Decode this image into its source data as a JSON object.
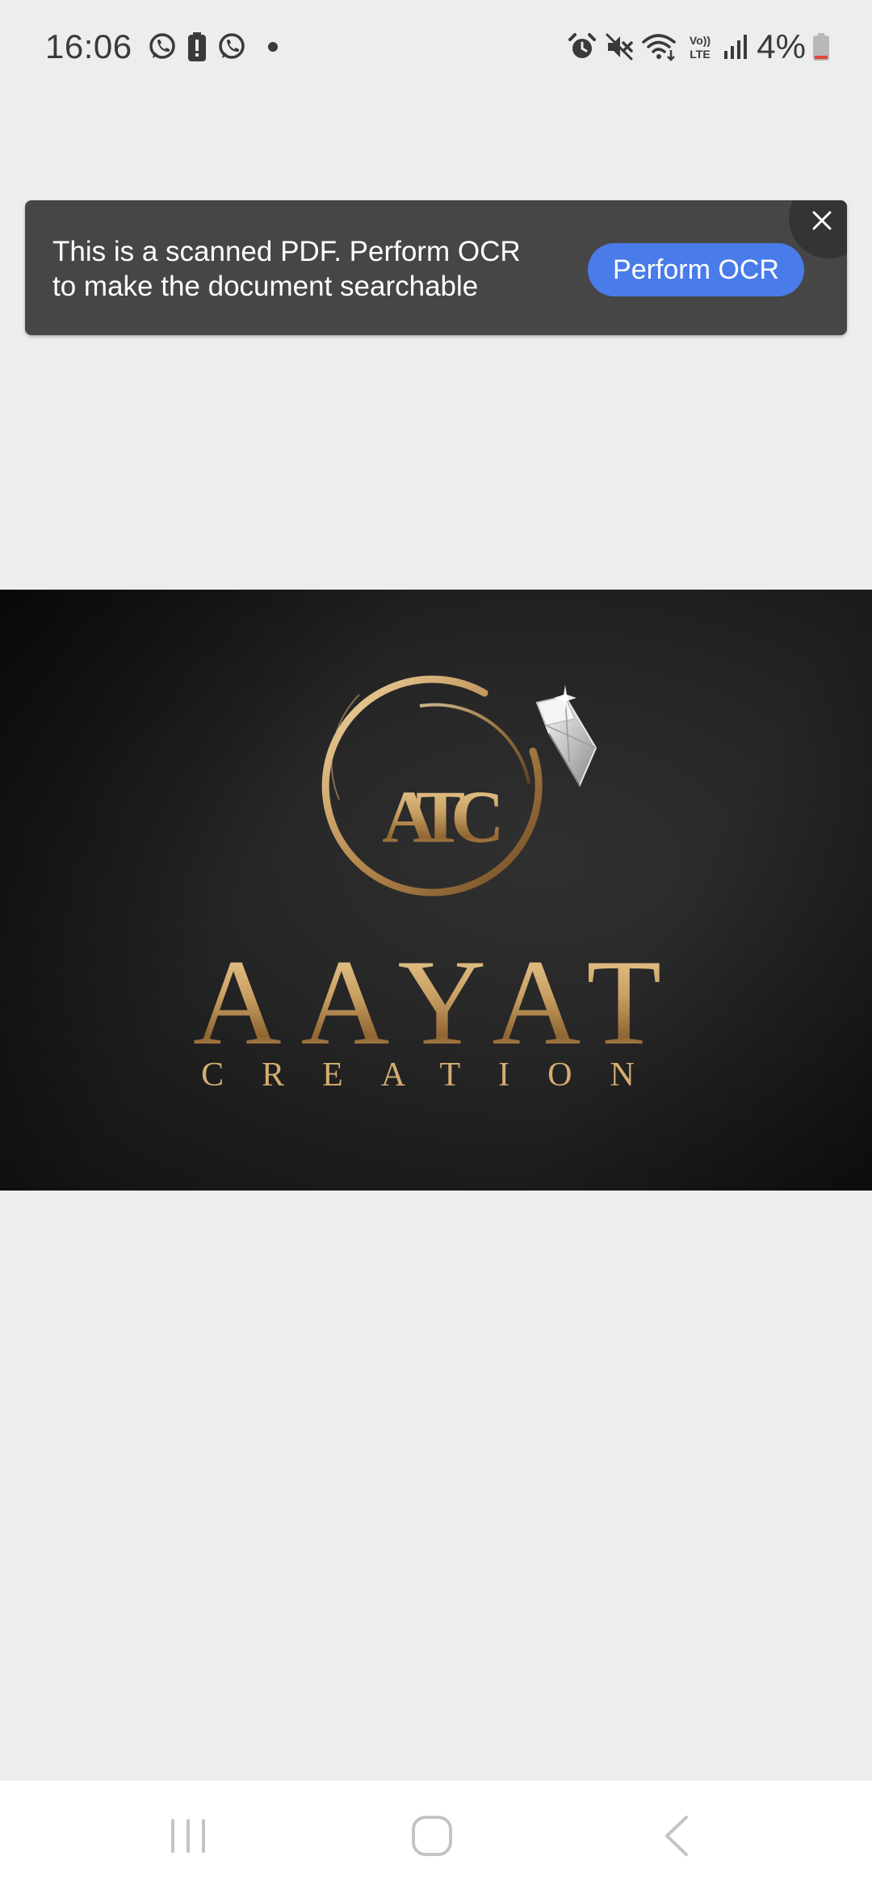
{
  "status_bar": {
    "time": "16:06",
    "battery_percent": "4%",
    "left_icons": [
      "whatsapp-icon",
      "battery-alert-icon",
      "whatsapp-icon",
      "notification-dot"
    ],
    "right_icons": [
      "alarm-icon",
      "mute-icon",
      "wifi-icon",
      "volte-icon",
      "signal-icon",
      "battery-icon"
    ]
  },
  "ocr_banner": {
    "message_line1": "This is a scanned PDF. Perform OCR",
    "message_line2": "to make the document searchable",
    "button_label": "Perform OCR",
    "close_icon": "close-icon"
  },
  "document": {
    "logo_monogram": "ATC",
    "logo_title": "AAYAT",
    "logo_subtitle": "CREATION"
  },
  "nav_bar": {
    "recents_icon": "recents-icon",
    "home_icon": "home-icon",
    "back_icon": "back-icon"
  },
  "colors": {
    "banner_bg": "#464646",
    "button_accent": "#4a7ce9",
    "page_bg": "#ededed",
    "gold": "#c9a063"
  }
}
